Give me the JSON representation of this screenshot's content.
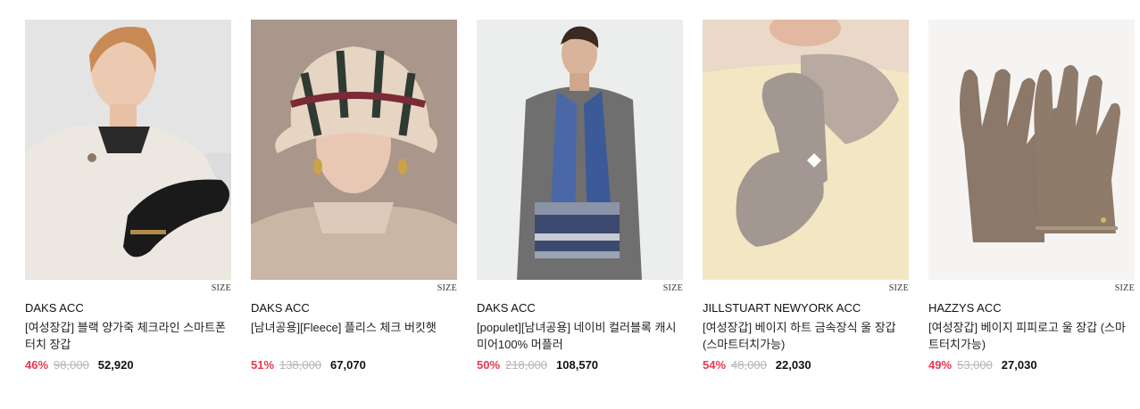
{
  "products": [
    {
      "image": "woman-black-leather-glove-photo",
      "size_label": "SIZE",
      "brand": "DAKS ACC",
      "name": "[여성장갑] 블랙 양가죽 체크라인 스마트폰 터치 장갑",
      "discount": "46%",
      "original_price": "98,000",
      "sale_price": "52,920"
    },
    {
      "image": "woman-check-fleece-bucket-hat-photo",
      "size_label": "SIZE",
      "brand": "DAKS ACC",
      "name": "[남녀공용][Fleece] 플리스 체크 버킷햇",
      "discount": "51%",
      "original_price": "138,000",
      "sale_price": "67,070"
    },
    {
      "image": "man-navy-blue-scarf-photo",
      "size_label": "SIZE",
      "brand": "DAKS ACC",
      "name": "[populet][남녀공용] 네이비 컬러블록 캐시미어100% 머플러",
      "discount": "50%",
      "original_price": "218,000",
      "sale_price": "108,570"
    },
    {
      "image": "beige-wool-glove-heart-photo",
      "size_label": "SIZE",
      "brand": "JILLSTUART NEWYORK ACC",
      "name": "[여성장갑] 베이지 하트 금속장식 울 장갑 (스마트터치가능)",
      "discount": "54%",
      "original_price": "48,000",
      "sale_price": "22,030"
    },
    {
      "image": "beige-wool-gloves-flatlay-photo",
      "size_label": "SIZE",
      "brand": "HAZZYS ACC",
      "name": "[여성장갑] 베이지 피피로고 울 장갑 (스마트터치가능)",
      "discount": "49%",
      "original_price": "53,000",
      "sale_price": "27,030"
    }
  ],
  "colors": {
    "discount": "#e8384f",
    "original_price": "#b5b5b5",
    "sale_price": "#111111"
  }
}
